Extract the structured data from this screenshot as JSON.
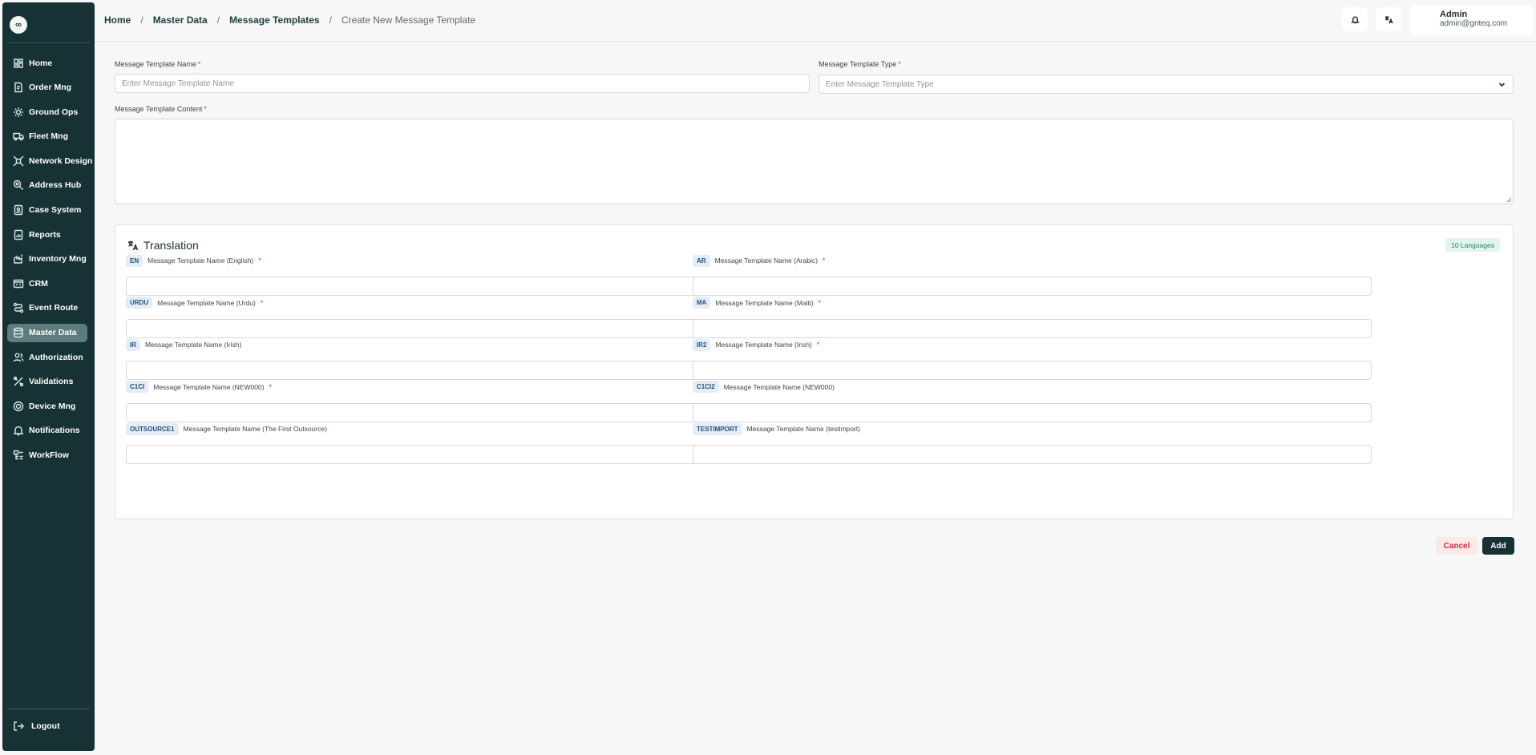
{
  "sidebar": {
    "logo": "∞",
    "items": [
      {
        "label": "Home",
        "icon": "home-icon",
        "active": false
      },
      {
        "label": "Order Mng",
        "icon": "order-icon",
        "active": false
      },
      {
        "label": "Ground Ops",
        "icon": "ground-ops-icon",
        "active": false
      },
      {
        "label": "Fleet Mng",
        "icon": "truck-icon",
        "active": false
      },
      {
        "label": "Network Design",
        "icon": "network-icon",
        "active": false
      },
      {
        "label": "Address Hub",
        "icon": "map-pin-icon",
        "active": false
      },
      {
        "label": "Case System",
        "icon": "case-icon",
        "active": false
      },
      {
        "label": "Reports",
        "icon": "report-icon",
        "active": false
      },
      {
        "label": "Inventory Mng",
        "icon": "inventory-icon",
        "active": false
      },
      {
        "label": "CRM",
        "icon": "crm-icon",
        "active": false
      },
      {
        "label": "Event Route",
        "icon": "route-icon",
        "active": false
      },
      {
        "label": "Master Data",
        "icon": "database-icon",
        "active": true
      },
      {
        "label": "Authorization",
        "icon": "users-icon",
        "active": false
      },
      {
        "label": "Validations",
        "icon": "validation-icon",
        "active": false
      },
      {
        "label": "Device Mng",
        "icon": "device-icon",
        "active": false
      },
      {
        "label": "Notifications",
        "icon": "bell-icon",
        "active": false
      },
      {
        "label": "WorkFlow",
        "icon": "workflow-icon",
        "active": false
      }
    ],
    "logout": "Logout"
  },
  "header": {
    "breadcrumb": [
      {
        "label": "Home"
      },
      {
        "label": "Master Data"
      },
      {
        "label": "Message Templates"
      },
      {
        "label": "Create New Message Template"
      }
    ],
    "separator": "/",
    "user": {
      "name": "Admin",
      "email": "admin@gnteq.com"
    }
  },
  "form": {
    "name": {
      "label": "Message Template Name",
      "required": "*",
      "placeholder": "Enter Message Template Name",
      "value": ""
    },
    "type": {
      "label": "Message Template Type",
      "required": "*",
      "placeholder": "Enter Message Template Type"
    },
    "content": {
      "label": "Message Template Content",
      "required": "*",
      "value": ""
    }
  },
  "translation": {
    "title": "Translation",
    "badge": "10 Languages",
    "fields": [
      {
        "code": "EN",
        "label": "Message Template Name (English)",
        "required": "*"
      },
      {
        "code": "AR",
        "label": "Message Template Name (Arabic)",
        "required": "*"
      },
      {
        "code": "URDU",
        "label": "Message Template Name (Urdu)",
        "required": "*"
      },
      {
        "code": "MA",
        "label": "Message Template Name (Malti)",
        "required": "*"
      },
      {
        "code": "IR",
        "label": "Message Template Name (Irish)",
        "required": ""
      },
      {
        "code": "IR2",
        "label": "Message Template Name (Irish)",
        "required": "*"
      },
      {
        "code": "C1CI",
        "label": "Message Template Name (NEW000)",
        "required": "*"
      },
      {
        "code": "C1CI2",
        "label": "Message Template Name (NEW000)",
        "required": ""
      },
      {
        "code": "OUTSOURCE1",
        "label": "Message Template Name (The First Outsource)",
        "required": ""
      },
      {
        "code": "TESTIMPORT",
        "label": "Message Template Name (testimport)",
        "required": ""
      }
    ]
  },
  "actions": {
    "cancel": "Cancel",
    "add": "Add"
  }
}
